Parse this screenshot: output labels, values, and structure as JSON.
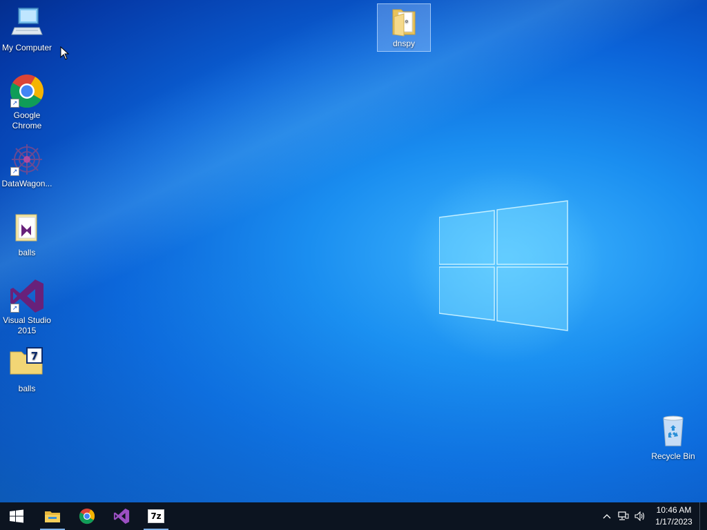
{
  "desktop": {
    "icons": [
      {
        "label": "My Computer"
      },
      {
        "label": "Google Chrome"
      },
      {
        "label": "DataWagon..."
      },
      {
        "label": "balls"
      },
      {
        "label": "Visual Studio 2015"
      },
      {
        "label": "balls"
      },
      {
        "label": "dnspy"
      },
      {
        "label": "Recycle Bin"
      }
    ]
  },
  "taskbar": {
    "items": [
      "start-icon",
      "file-explorer-icon",
      "chrome-icon",
      "visual-studio-icon",
      "7zip-icon"
    ],
    "seven_zip_label": "7z",
    "tray": {
      "chevron": "^",
      "time": "10:46 AM",
      "date": "1/17/2023"
    }
  },
  "colors": {
    "desktop_accent": "#1a8ef0",
    "taskbar": "#0c1420",
    "vs_purple": "#68217a"
  }
}
